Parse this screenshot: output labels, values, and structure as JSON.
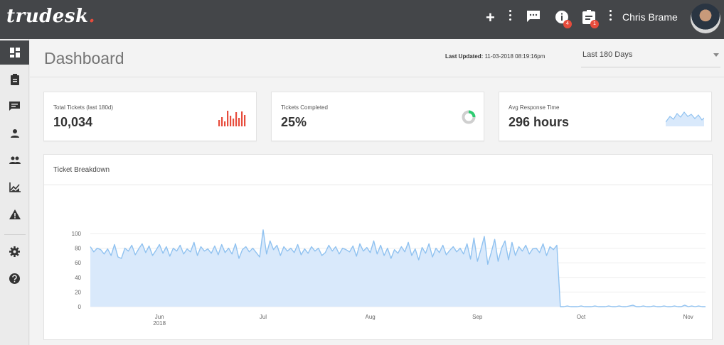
{
  "app": {
    "logo_text": "trudesk",
    "logo_dot": ".",
    "user_name": "Chris Brame",
    "notifications_count": "4",
    "tickets_badge_count": "1",
    "colors": {
      "topbar": "#444649",
      "accent": "#e74c3c",
      "chart_fill": "#d9e9fb",
      "chart_line": "#90c2f0"
    }
  },
  "topbar_icons": [
    "plus-icon",
    "kebab-menu-icon",
    "chat-icon",
    "info-icon",
    "assignment-icon",
    "kebab-menu-icon"
  ],
  "sidebar": {
    "items": [
      {
        "icon": "dashboard-icon",
        "active": true
      },
      {
        "icon": "clipboard-icon",
        "active": false
      },
      {
        "icon": "chat-icon",
        "active": false
      },
      {
        "icon": "person-icon",
        "active": false
      },
      {
        "icon": "group-icon",
        "active": false
      },
      {
        "icon": "reports-icon",
        "active": false
      },
      {
        "icon": "warning-icon",
        "active": false
      },
      {
        "icon": "settings-icon",
        "active": false
      },
      {
        "icon": "help-icon",
        "active": false
      }
    ]
  },
  "dashboard": {
    "title": "Dashboard",
    "last_updated_label": "Last Updated:",
    "last_updated_value": "11-03-2018 08:19:16pm",
    "range_selected": "Last 180 Days",
    "cards": {
      "total": {
        "label": "Total Tickets (last 180d)",
        "value": "10,034"
      },
      "completed": {
        "label": "Tickets Completed",
        "value": "25%",
        "percent": 25
      },
      "response": {
        "label": "Avg Response Time",
        "value": "296 hours"
      }
    }
  },
  "chart_data": {
    "type": "area",
    "title": "Ticket Breakdown",
    "xlabel": "",
    "ylabel": "",
    "ylim": [
      0,
      100
    ],
    "yticks": [
      0,
      20,
      40,
      60,
      80,
      100
    ],
    "x_tick_labels": [
      {
        "label": "Jun",
        "sublabel": "2018",
        "day": 20
      },
      {
        "label": "Jul",
        "sublabel": "",
        "day": 50
      },
      {
        "label": "Aug",
        "sublabel": "",
        "day": 81
      },
      {
        "label": "Sep",
        "sublabel": "",
        "day": 112
      },
      {
        "label": "Oct",
        "sublabel": "",
        "day": 142
      },
      {
        "label": "Nov",
        "sublabel": "",
        "day": 173
      }
    ],
    "series": [
      {
        "values": [
          82,
          75,
          80,
          78,
          72,
          79,
          70,
          85,
          68,
          66,
          80,
          76,
          84,
          71,
          79,
          86,
          74,
          83,
          70,
          77,
          85,
          73,
          82,
          69,
          80,
          76,
          84,
          72,
          79,
          75,
          88,
          70,
          82,
          76,
          79,
          73,
          83,
          71,
          85,
          74,
          80,
          72,
          86,
          66,
          78,
          82,
          75,
          80,
          74,
          68,
          105,
          72,
          90,
          78,
          84,
          70,
          82,
          76,
          80,
          74,
          85,
          71,
          79,
          73,
          82,
          76,
          80,
          70,
          74,
          84,
          76,
          82,
          72,
          80,
          78,
          75,
          83,
          69,
          86,
          76,
          81,
          74,
          90,
          72,
          84,
          70,
          80,
          66,
          78,
          73,
          82,
          75,
          88,
          70,
          79,
          64,
          81,
          73,
          86,
          68,
          80,
          74,
          84,
          71,
          77,
          82,
          75,
          80,
          72,
          86,
          65,
          94,
          62,
          78,
          96,
          58,
          74,
          92,
          62,
          80,
          90,
          64,
          88,
          70,
          82,
          76,
          84,
          72,
          79,
          80,
          74,
          86,
          70,
          82,
          78,
          84,
          0,
          0,
          1,
          0,
          0,
          0,
          1,
          0,
          0,
          0,
          1,
          0,
          0,
          0,
          1,
          0,
          0,
          1,
          0,
          0,
          1,
          2,
          0,
          0,
          1,
          0,
          0,
          1,
          0,
          0,
          1,
          0,
          0,
          1,
          0,
          0,
          2,
          0,
          1,
          0,
          1,
          0,
          0
        ]
      }
    ]
  }
}
